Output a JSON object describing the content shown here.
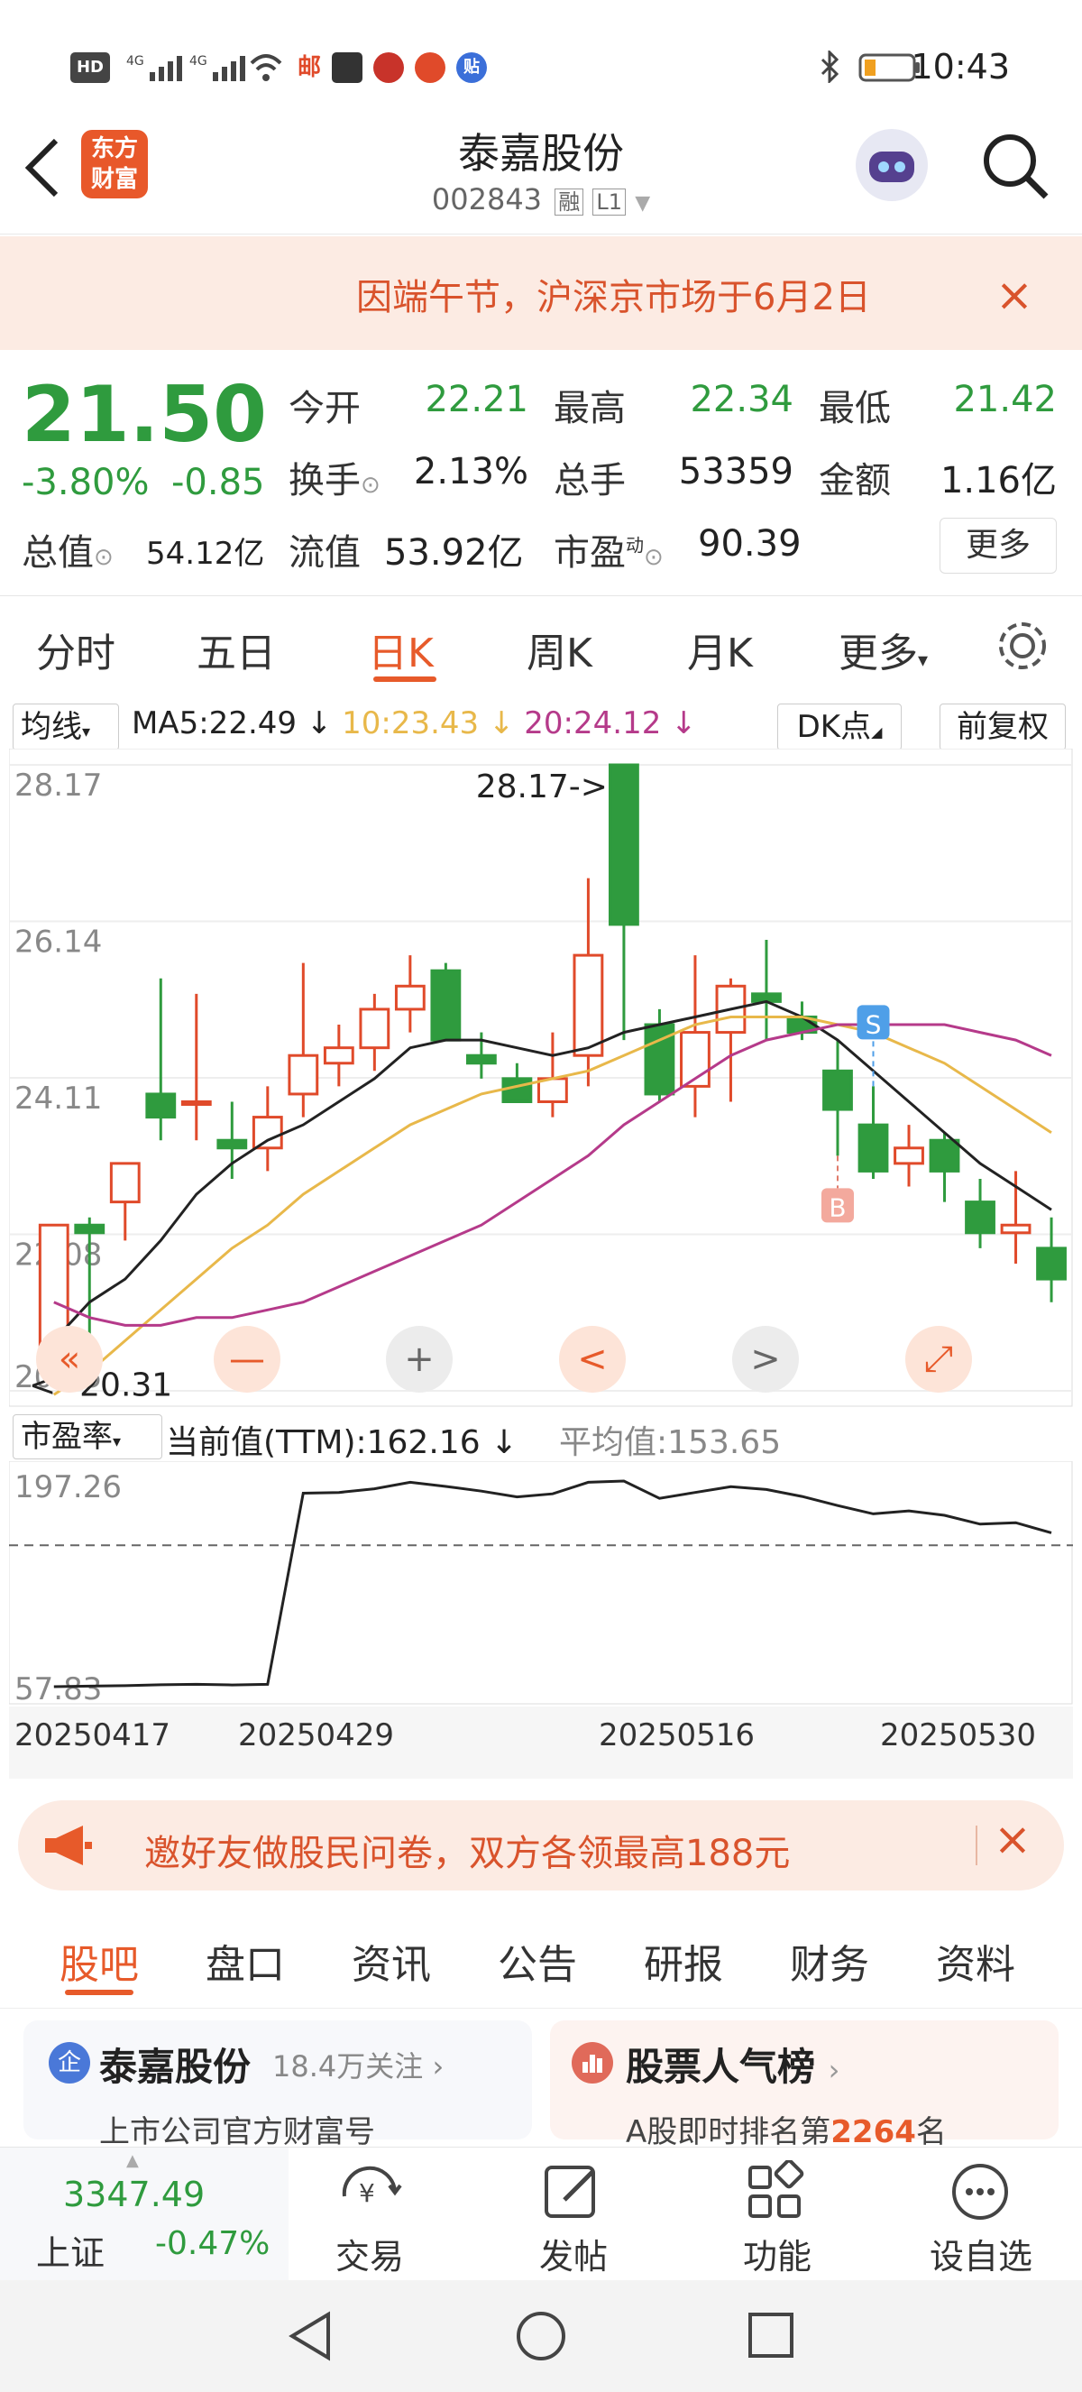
{
  "status_bar": {
    "left_icons": [
      "HD",
      "4G",
      "4G",
      "wifi",
      "邮",
      "mail",
      "招",
      "网易",
      "贴"
    ],
    "right_icons": [
      "bluetooth",
      "battery"
    ],
    "time": "10:43"
  },
  "header": {
    "back_icon": "back-arrow",
    "logo_line1": "东方",
    "logo_line2": "财富",
    "title": "泰嘉股份",
    "code": "002843",
    "tag_rong": "融",
    "tag_level": "L1",
    "search_icon": "search"
  },
  "notice": {
    "text": "因端午节，沪深京市场于6月2日",
    "close": "×"
  },
  "quote": {
    "price": "21.50",
    "change_pct": "-3.80%",
    "change_abs": "-0.85",
    "open_label": "今开",
    "open": "22.21",
    "high_label": "最高",
    "high": "22.34",
    "low_label": "最低",
    "low": "21.42",
    "turnover_label": "换手",
    "turnover": "2.13%",
    "volume_label": "总手",
    "volume": "53359",
    "amount_label": "金额",
    "amount": "1.16亿",
    "mktcap_label": "总值",
    "mktcap": "54.12亿",
    "float_label": "流值",
    "float": "53.92亿",
    "pe_label": "市盈",
    "pe_sup": "动",
    "pe": "90.39",
    "more": "更多"
  },
  "period_tabs": {
    "items": [
      "分时",
      "五日",
      "日K",
      "周K",
      "月K",
      "更多"
    ],
    "active": "日K"
  },
  "indicator": {
    "selector": "均线",
    "ma5": "MA5:22.49",
    "ma10": "10:23.43",
    "ma20": "20:24.12",
    "dk": "DK点",
    "adjust": "前复权"
  },
  "chart_data": {
    "type": "candlestick",
    "y_ticks": [
      "28.17",
      "26.14",
      "24.11",
      "22.08",
      "20.05"
    ],
    "ylim": [
      20.05,
      28.17
    ],
    "max_label": "28.17->",
    "min_label": "<--20.31",
    "candles": [
      {
        "o": 20.6,
        "h": 22.2,
        "l": 20.2,
        "c": 22.2
      },
      {
        "o": 22.2,
        "h": 22.3,
        "l": 20.1,
        "c": 22.1
      },
      {
        "o": 22.5,
        "h": 23.0,
        "l": 22.0,
        "c": 23.0
      },
      {
        "o": 23.9,
        "h": 25.4,
        "l": 23.3,
        "c": 23.6
      },
      {
        "o": 23.8,
        "h": 25.2,
        "l": 23.3,
        "c": 23.8
      },
      {
        "o": 23.3,
        "h": 23.8,
        "l": 22.8,
        "c": 23.2
      },
      {
        "o": 23.2,
        "h": 24.0,
        "l": 22.9,
        "c": 23.6
      },
      {
        "o": 23.9,
        "h": 25.6,
        "l": 23.6,
        "c": 24.4
      },
      {
        "o": 24.3,
        "h": 24.8,
        "l": 24.0,
        "c": 24.5
      },
      {
        "o": 24.5,
        "h": 25.2,
        "l": 24.2,
        "c": 25.0
      },
      {
        "o": 25.0,
        "h": 25.7,
        "l": 24.7,
        "c": 25.3
      },
      {
        "o": 25.5,
        "h": 25.6,
        "l": 24.6,
        "c": 24.6
      },
      {
        "o": 24.4,
        "h": 24.7,
        "l": 24.1,
        "c": 24.3
      },
      {
        "o": 24.1,
        "h": 24.3,
        "l": 23.8,
        "c": 23.8
      },
      {
        "o": 23.8,
        "h": 24.7,
        "l": 23.6,
        "c": 24.1
      },
      {
        "o": 24.4,
        "h": 26.7,
        "l": 24.0,
        "c": 25.7
      },
      {
        "o": 28.17,
        "h": 28.17,
        "l": 24.6,
        "c": 26.1
      },
      {
        "o": 24.8,
        "h": 25.0,
        "l": 23.8,
        "c": 23.9
      },
      {
        "o": 24.0,
        "h": 25.7,
        "l": 23.6,
        "c": 24.7
      },
      {
        "o": 24.7,
        "h": 25.4,
        "l": 23.8,
        "c": 25.3
      },
      {
        "o": 25.2,
        "h": 25.9,
        "l": 24.6,
        "c": 25.1
      },
      {
        "o": 24.9,
        "h": 25.1,
        "l": 24.6,
        "c": 24.7
      },
      {
        "o": 24.2,
        "h": 24.6,
        "l": 23.1,
        "c": 23.7
      },
      {
        "o": 23.5,
        "h": 24.0,
        "l": 22.8,
        "c": 22.9
      },
      {
        "o": 23.0,
        "h": 23.5,
        "l": 22.7,
        "c": 23.2
      },
      {
        "o": 23.3,
        "h": 23.4,
        "l": 22.5,
        "c": 22.9
      },
      {
        "o": 22.5,
        "h": 22.8,
        "l": 21.9,
        "c": 22.1
      },
      {
        "o": 22.1,
        "h": 22.9,
        "l": 21.7,
        "c": 22.2
      },
      {
        "o": 21.9,
        "h": 22.3,
        "l": 21.2,
        "c": 21.5
      }
    ],
    "ma5": [
      20.7,
      21.2,
      21.5,
      22.0,
      22.6,
      23.0,
      23.3,
      23.5,
      23.8,
      24.1,
      24.5,
      24.6,
      24.6,
      24.5,
      24.4,
      24.5,
      24.7,
      24.8,
      24.9,
      25.0,
      25.1,
      24.9,
      24.6,
      24.2,
      23.8,
      23.4,
      23.0,
      22.7,
      22.4
    ],
    "ma10": [
      20.0,
      20.3,
      20.7,
      21.1,
      21.5,
      21.9,
      22.2,
      22.6,
      22.9,
      23.2,
      23.5,
      23.7,
      23.9,
      24.0,
      24.1,
      24.2,
      24.4,
      24.6,
      24.8,
      24.9,
      24.9,
      24.9,
      24.8,
      24.7,
      24.5,
      24.3,
      24.0,
      23.7,
      23.4
    ],
    "ma20": [
      21.2,
      21.0,
      20.9,
      20.9,
      21.0,
      21.0,
      21.1,
      21.2,
      21.4,
      21.6,
      21.8,
      22.0,
      22.2,
      22.5,
      22.8,
      23.1,
      23.5,
      23.8,
      24.1,
      24.4,
      24.6,
      24.7,
      24.8,
      24.8,
      24.8,
      24.8,
      24.7,
      24.6,
      24.4
    ],
    "markers": [
      {
        "label": "S",
        "index": 23
      },
      {
        "label": "B",
        "index": 22
      }
    ],
    "ma_colors": {
      "ma5": "#222222",
      "ma10": "#e8b84a",
      "ma20": "#b53a8a"
    },
    "up_color": "#e04a2a",
    "down_color": "#2f9b3e"
  },
  "chart_controls": [
    "«",
    "—",
    "+",
    "<",
    ">",
    "expand"
  ],
  "pe_panel": {
    "selector": "市盈率",
    "current": "当前值(TTM):162.16",
    "average": "平均值:153.65",
    "y_ticks": [
      "197.26",
      "57.83"
    ],
    "ylim": [
      57.83,
      197.26
    ],
    "avg": 153.65,
    "values": [
      57.83,
      58.2,
      58.5,
      59.1,
      59.4,
      59.0,
      59.4,
      189.0,
      189.5,
      192.0,
      196.4,
      193.6,
      190.4,
      186.5,
      188.6,
      196.4,
      197.26,
      185.5,
      189.5,
      193.4,
      191.5,
      186.8,
      180.6,
      175.0,
      177.0,
      174.0,
      168.0,
      169.0,
      162.16
    ],
    "dates": [
      "20250417",
      "20250429",
      "20250516",
      "20250530"
    ]
  },
  "invite": {
    "text": "邀好友做股民问卷，双方各领最高188元",
    "close": "×"
  },
  "bottom_tabs": {
    "items": [
      "股吧",
      "盘口",
      "资讯",
      "公告",
      "研报",
      "财务",
      "资料"
    ],
    "active": "股吧"
  },
  "cards": [
    {
      "badge": "企",
      "title": "泰嘉股份",
      "meta": "18.4万关注",
      "sub": "上市公司官方财富号"
    },
    {
      "title": "股票人气榜",
      "sub_prefix": "A股即时排名第",
      "rank": "2264",
      "sub_suffix": "名"
    }
  ],
  "index": {
    "value": "3347.49",
    "name": "上证",
    "change": "-0.47%"
  },
  "nav": [
    "交易",
    "发帖",
    "功能",
    "设自选"
  ]
}
